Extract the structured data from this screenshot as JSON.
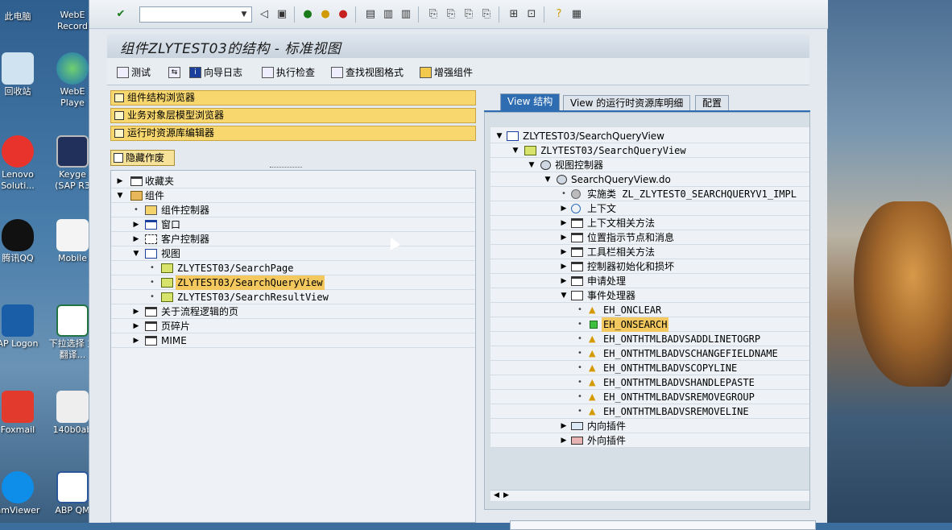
{
  "desktop": {
    "icons": [
      {
        "label": "此电脑"
      },
      {
        "label": "WebE Record"
      },
      {
        "label": "回收站"
      },
      {
        "label": "WebE Playe"
      },
      {
        "label": "Lenovo Soluti..."
      },
      {
        "label": "Keyge (SAP R3"
      },
      {
        "label": "腾讯QQ"
      },
      {
        "label": "Mobile"
      },
      {
        "label": "AP Logon"
      },
      {
        "label": "下拉选择 文翻译..."
      },
      {
        "label": "Foxmail"
      },
      {
        "label": "140b0ab"
      },
      {
        "label": "amViewer"
      },
      {
        "label": "ABP QM"
      }
    ]
  },
  "toolbar": {
    "command_field_value": ""
  },
  "title": "组件ZLYTEST03的结构 - 标准视图",
  "app_toolbar": {
    "test": "测试",
    "wizard_log": "向导日志",
    "run_check": "执行检查",
    "find_view_format": "查找视图格式",
    "enhance_component": "增强组件"
  },
  "left": {
    "links": [
      "组件结构浏览器",
      "业务对象层模型浏览器",
      "运行时资源库编辑器"
    ],
    "hide_button": "隐藏作废",
    "tree": {
      "favorites": "收藏夹",
      "component": "组件",
      "component_controller": "组件控制器",
      "window": "窗口",
      "custom_controller": "客户控制器",
      "views": "视图",
      "view_items": [
        "ZLYTEST03/SearchPage",
        "ZLYTEST03/SearchQueryView",
        "ZLYTEST03/SearchResultView"
      ],
      "process_logic_pages": "关于流程逻辑的页",
      "page_fragments": "页碎片",
      "mime": "MIME"
    }
  },
  "right": {
    "tabs": [
      "View 结构",
      "View 的运行时资源库明细",
      "配置"
    ],
    "tree": {
      "root": "ZLYTEST03/SearchQueryView",
      "view": "ZLYTEST03/SearchQueryView",
      "view_controller": "视图控制器",
      "controller_file": "SearchQueryView.do",
      "impl_class": "实施类 ZL_ZLYTEST0_SEARCHQUERYV1_IMPL",
      "context": "上下文",
      "context_methods": "上下文相关方法",
      "location_nodes": "位置指示节点和消息",
      "toolbar_methods": "工具栏相关方法",
      "controller_init": "控制器初始化和损坏",
      "request_processing": "申请处理",
      "event_handlers": "事件处理器",
      "events": [
        "EH_ONCLEAR",
        "EH_ONSEARCH",
        "EH_ONTHTMLBADVSADDLINETOGRP",
        "EH_ONTHTMLBADVSCHANGEFIELDNAME",
        "EH_ONTHTMLBADVSCOPYLINE",
        "EH_ONTHTMLBADVSHANDLEPASTE",
        "EH_ONTHTMLBADVSREMOVEGROUP",
        "EH_ONTHTMLBADVSREMOVELINE"
      ],
      "inbound_plugs": "内向插件",
      "outbound_plugs": "外向插件"
    }
  },
  "colors": {
    "link_yellow": "#f7d76e",
    "tab_active": "#2f6db3",
    "highlight": "#f3c85e"
  }
}
